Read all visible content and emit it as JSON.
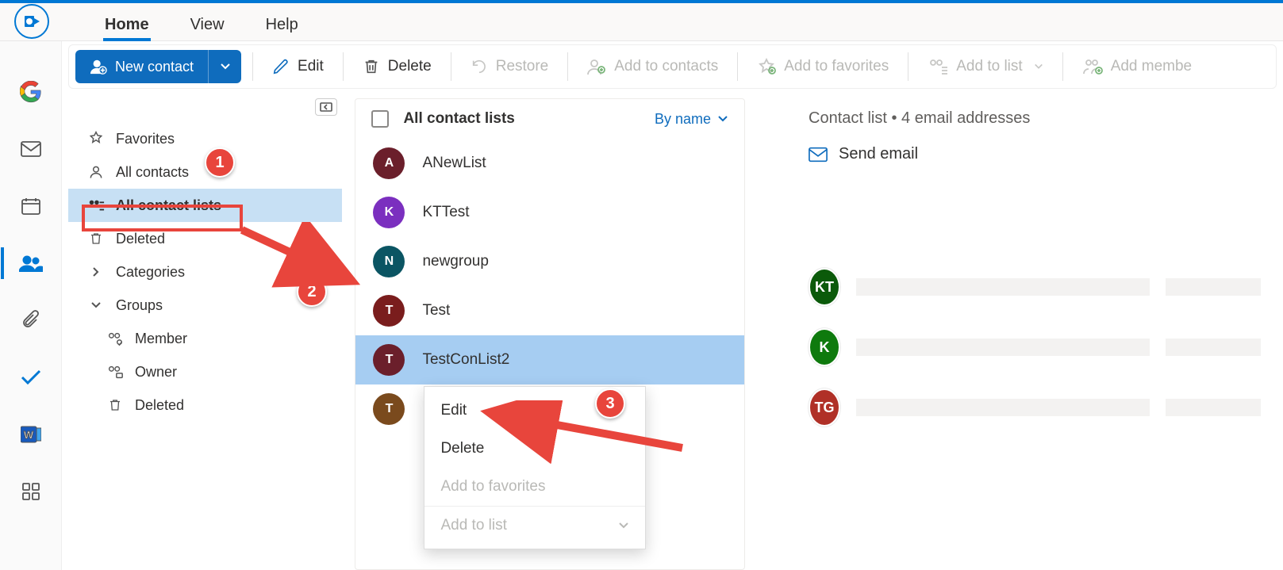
{
  "tabs": {
    "home": "Home",
    "view": "View",
    "help": "Help"
  },
  "toolbar": {
    "new_contact": "New contact",
    "edit": "Edit",
    "delete": "Delete",
    "restore": "Restore",
    "add_contacts": "Add to contacts",
    "add_favorites": "Add to favorites",
    "add_to_list": "Add to list",
    "add_member": "Add membe"
  },
  "sidenav": {
    "favorites": "Favorites",
    "all_contacts": "All contacts",
    "all_contact_lists": "All contact lists",
    "deleted": "Deleted",
    "categories": "Categories",
    "groups": "Groups",
    "member": "Member",
    "owner": "Owner",
    "groups_deleted": "Deleted"
  },
  "mid": {
    "title": "All contact lists",
    "sort": "By name",
    "rows": [
      {
        "initial": "A",
        "label": "ANewList",
        "color": "c-darkred"
      },
      {
        "initial": "K",
        "label": "KTTest",
        "color": "c-purple"
      },
      {
        "initial": "N",
        "label": "newgroup",
        "color": "c-teal"
      },
      {
        "initial": "T",
        "label": "Test",
        "color": "c-maroon"
      },
      {
        "initial": "T",
        "label": "TestConList2",
        "color": "c-darkred"
      },
      {
        "initial": "T",
        "label": "",
        "color": "c-brown"
      }
    ]
  },
  "context_menu": {
    "edit": "Edit",
    "delete": "Delete",
    "add_fav": "Add to favorites",
    "add_list": "Add to list"
  },
  "detail": {
    "meta": "Contact list • 4 email addresses",
    "send_email": "Send email",
    "members": [
      {
        "initial": "KT",
        "color": "c-dgreen"
      },
      {
        "initial": "K",
        "color": "c-green"
      },
      {
        "initial": "TG",
        "color": "c-ored"
      }
    ]
  },
  "annotations": {
    "b1": "1",
    "b2": "2",
    "b3": "3"
  }
}
